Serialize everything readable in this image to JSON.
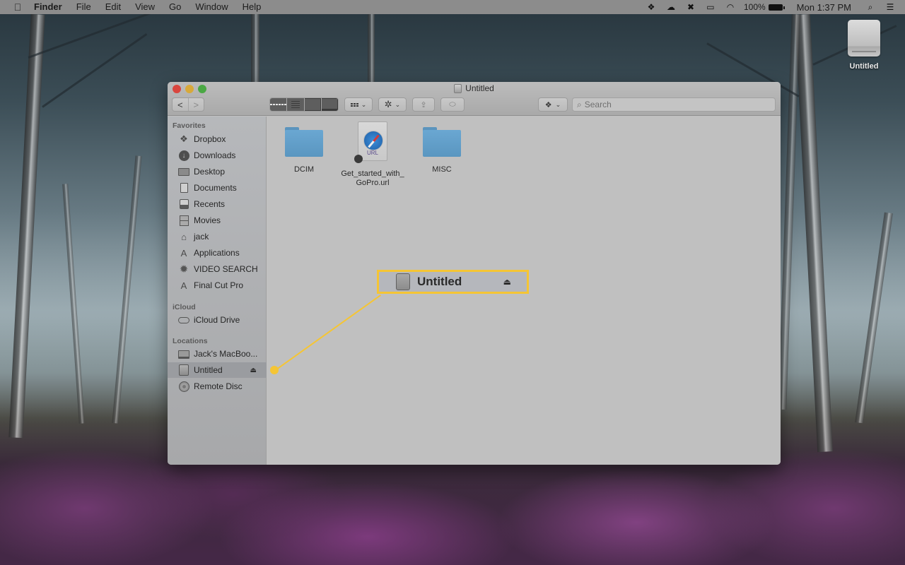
{
  "menubar": {
    "apple_icon": "apple-icon",
    "app_name": "Finder",
    "menus": [
      "File",
      "Edit",
      "View",
      "Go",
      "Window",
      "Help"
    ],
    "status_icons": [
      "dropbox-icon",
      "cloud-upload-icon",
      "bug-icon",
      "airplay-icon",
      "wifi-icon"
    ],
    "battery_percent": "100%",
    "clock": "Mon 1:37 PM"
  },
  "desktop": {
    "drive_label": "Untitled"
  },
  "window": {
    "title": "Untitled",
    "toolbar": {
      "back": "<",
      "forward": ">",
      "search_placeholder": "Search",
      "search_value": ""
    },
    "sidebar": {
      "sections": [
        {
          "heading": "Favorites",
          "items": [
            {
              "label": "Dropbox",
              "icon": "dropbox-icon"
            },
            {
              "label": "Downloads",
              "icon": "downloads-icon"
            },
            {
              "label": "Desktop",
              "icon": "desktop-icon"
            },
            {
              "label": "Documents",
              "icon": "documents-icon"
            },
            {
              "label": "Recents",
              "icon": "recents-icon"
            },
            {
              "label": "Movies",
              "icon": "movies-icon"
            },
            {
              "label": "jack",
              "icon": "home-icon"
            },
            {
              "label": "Applications",
              "icon": "applications-icon"
            },
            {
              "label": "VIDEO SEARCH",
              "icon": "gear-icon"
            },
            {
              "label": "Final Cut Pro",
              "icon": "applications-icon"
            }
          ]
        },
        {
          "heading": "iCloud",
          "items": [
            {
              "label": "iCloud Drive",
              "icon": "cloud-icon"
            }
          ]
        },
        {
          "heading": "Locations",
          "items": [
            {
              "label": "Jack's MacBoo...",
              "icon": "laptop-icon"
            },
            {
              "label": "Untitled",
              "icon": "drive-icon",
              "selected": true,
              "eject": "⏏"
            },
            {
              "label": "Remote Disc",
              "icon": "disc-icon"
            }
          ]
        }
      ]
    },
    "files": [
      {
        "name": "DCIM",
        "type": "folder"
      },
      {
        "name": "Get_started_with_\nGoPro.url",
        "line1": "Get_started_with_",
        "line2": "GoPro.url",
        "type": "url",
        "badge": "URL"
      },
      {
        "name": "MISC",
        "type": "folder"
      }
    ]
  },
  "callout": {
    "label": "Untitled",
    "eject": "⏏",
    "color": "#f5c534"
  }
}
